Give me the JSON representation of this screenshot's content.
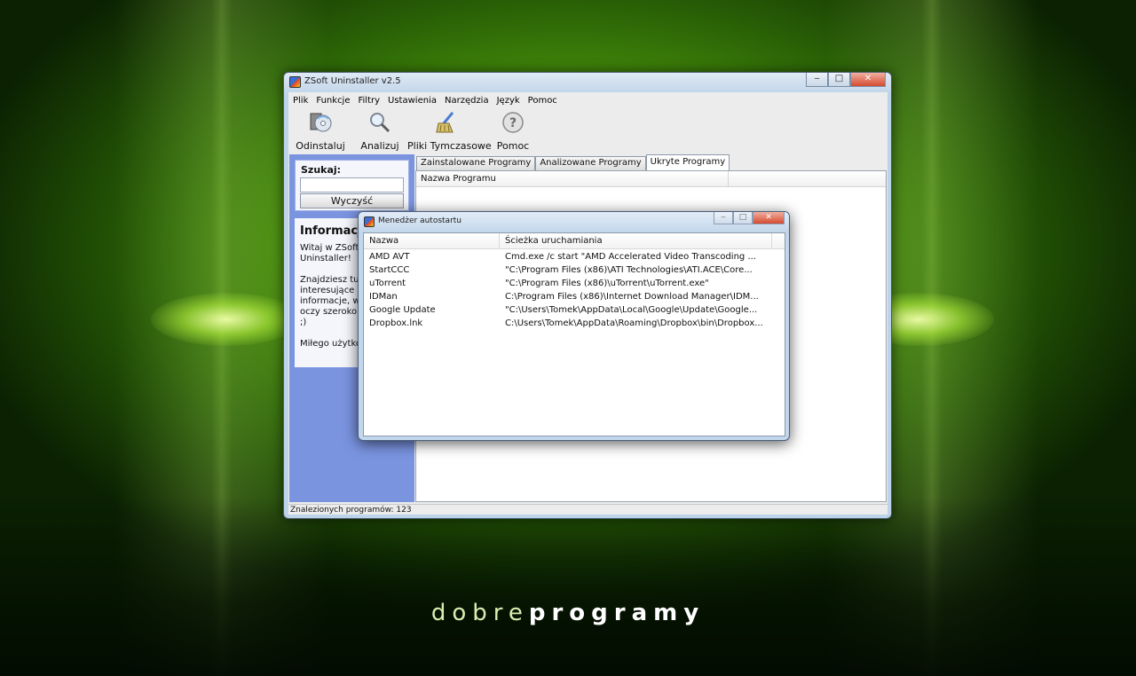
{
  "brand": {
    "part1": "dobre",
    "part2": "programy"
  },
  "main_window": {
    "title": "ZSoft Uninstaller v2.5",
    "buttons": {
      "minimize": "‒",
      "maximize": "□",
      "close": "✕"
    },
    "menu": [
      "Plik",
      "Funkcje",
      "Filtry",
      "Ustawienia",
      "Narzędzia",
      "Język",
      "Pomoc"
    ],
    "toolbar": [
      {
        "label": "Odinstaluj",
        "icon": "uninstall-cd-icon"
      },
      {
        "label": "Analizuj",
        "icon": "magnifier-icon"
      },
      {
        "label": "Pliki Tymczasowe",
        "icon": "broom-icon"
      },
      {
        "label": "Pomoc",
        "icon": "help-question-icon"
      }
    ],
    "sidebar": {
      "search_label": "Szukaj:",
      "search_value": "",
      "clear_button": "Wyczyść",
      "info_title": "Informacje",
      "info_text": "Witaj w ZSoft\nUninstaller!\n\nZnajdziesz tu\ninteresujące\ninformacje, w\noczy szeroko\n;)\n\nMiłego użytkowania"
    },
    "tabs": [
      "Zainstalowane Programy",
      "Analizowane Programy",
      "Ukryte Programy"
    ],
    "active_tab": 2,
    "list_column": "Nazwa Programu",
    "status": "Znalezionych programów: 123"
  },
  "dialog": {
    "title": "Menedżer autostartu",
    "columns": [
      "Nazwa",
      "Ścieżka uruchamiania"
    ],
    "rows": [
      {
        "name": "AMD AVT",
        "path": "Cmd.exe /c start \"AMD Accelerated Video Transcoding ..."
      },
      {
        "name": "StartCCC",
        "path": "\"C:\\Program Files (x86)\\ATI Technologies\\ATI.ACE\\Core..."
      },
      {
        "name": "uTorrent",
        "path": "\"C:\\Program Files (x86)\\uTorrent\\uTorrent.exe\""
      },
      {
        "name": "IDMan",
        "path": "C:\\Program Files (x86)\\Internet Download Manager\\IDM..."
      },
      {
        "name": "Google Update",
        "path": "\"C:\\Users\\Tomek\\AppData\\Local\\Google\\Update\\Google..."
      },
      {
        "name": "Dropbox.lnk",
        "path": "C:\\Users\\Tomek\\AppData\\Roaming\\Dropbox\\bin\\Dropbox..."
      }
    ]
  },
  "colors": {
    "sidebar": "#7a94e0",
    "desktop_accent": "#7fc81d"
  }
}
